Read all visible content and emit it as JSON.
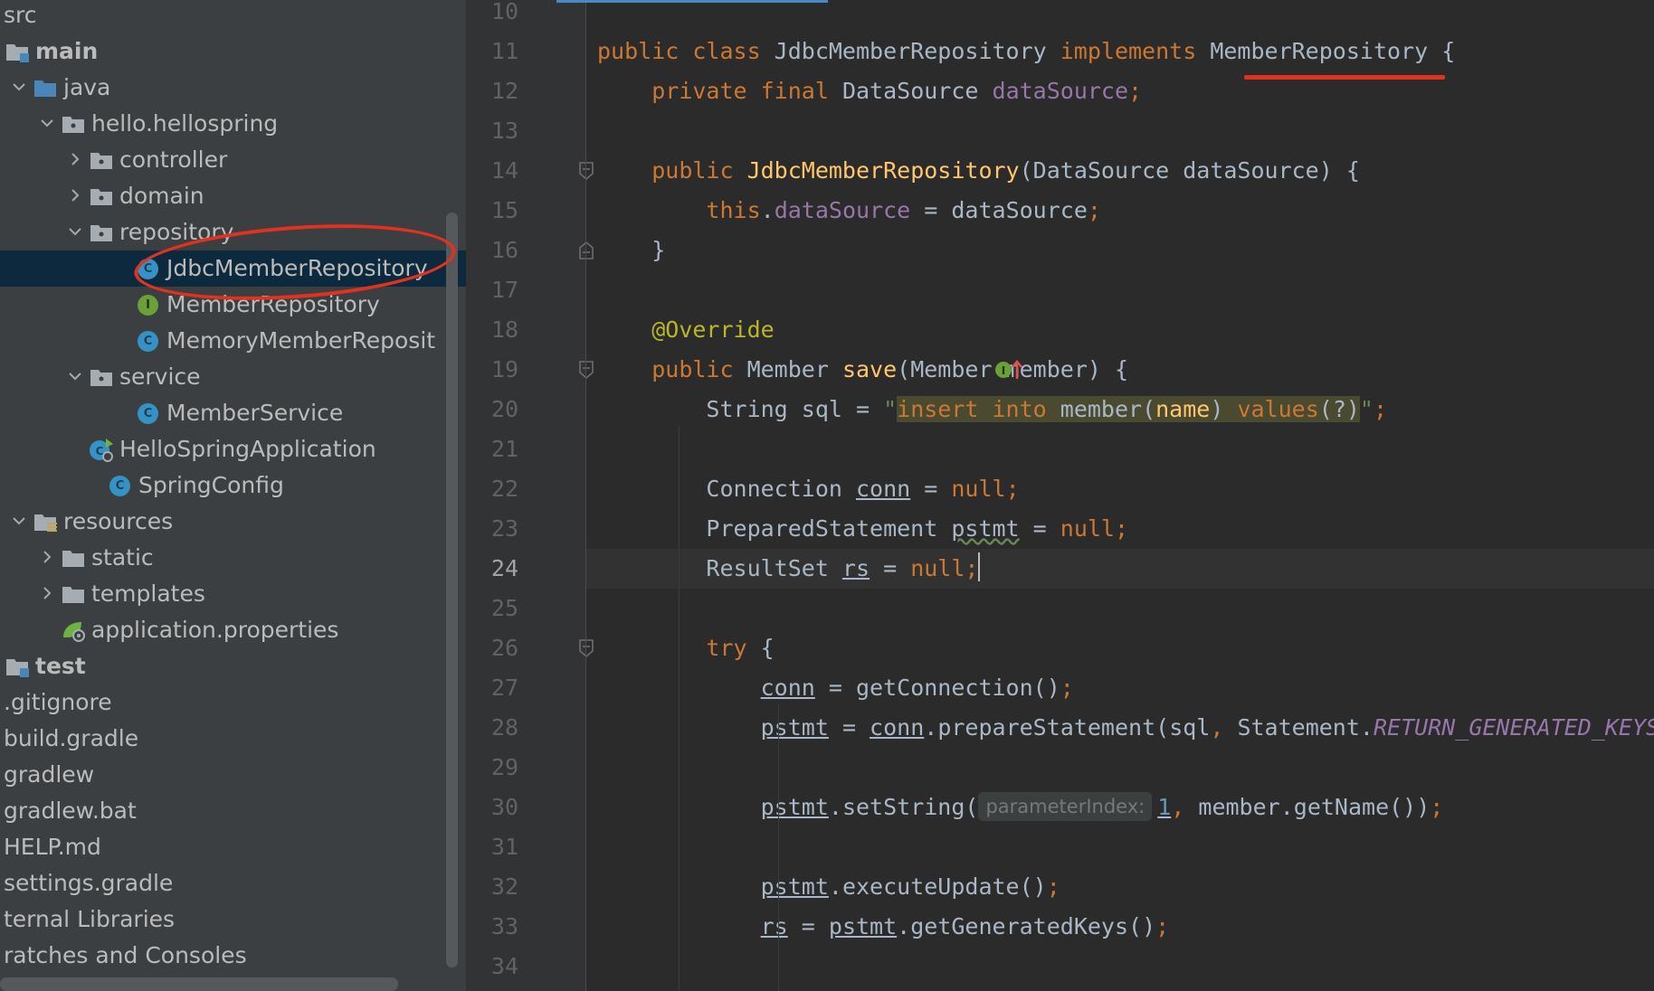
{
  "tree": {
    "items": [
      {
        "label": "src",
        "depth": 0,
        "icon": "none",
        "chevron": "none"
      },
      {
        "label": "main",
        "depth": 0,
        "icon": "module-folder-icon",
        "chevron": "none",
        "bold": true
      },
      {
        "label": "java",
        "depth": 1,
        "icon": "source-folder-icon",
        "chevron": "down"
      },
      {
        "label": "hello.hellospring",
        "depth": 2,
        "icon": "package-icon",
        "chevron": "down"
      },
      {
        "label": "controller",
        "depth": 3,
        "icon": "package-icon",
        "chevron": "right"
      },
      {
        "label": "domain",
        "depth": 3,
        "icon": "package-icon",
        "chevron": "right"
      },
      {
        "label": "repository",
        "depth": 3,
        "icon": "package-icon",
        "chevron": "down"
      },
      {
        "label": "JdbcMemberRepository",
        "depth": 4,
        "icon": "class-icon",
        "chevron": "none",
        "selected": true
      },
      {
        "label": "MemberRepository",
        "depth": 4,
        "icon": "interface-icon",
        "chevron": "none"
      },
      {
        "label": "MemoryMemberReposit",
        "depth": 4,
        "icon": "class-icon",
        "chevron": "none"
      },
      {
        "label": "service",
        "depth": 3,
        "icon": "package-icon",
        "chevron": "down"
      },
      {
        "label": "MemberService",
        "depth": 4,
        "icon": "class-icon",
        "chevron": "none"
      },
      {
        "label": "HelloSpringApplication",
        "depth": 3,
        "icon": "spring-boot-class-icon",
        "chevron": "none"
      },
      {
        "label": "SpringConfig",
        "depth": 3,
        "icon": "class-icon",
        "chevron": "none"
      },
      {
        "label": "resources",
        "depth": 1,
        "icon": "resources-folder-icon",
        "chevron": "down"
      },
      {
        "label": "static",
        "depth": 2,
        "icon": "folder-icon",
        "chevron": "right"
      },
      {
        "label": "templates",
        "depth": 2,
        "icon": "folder-icon",
        "chevron": "right"
      },
      {
        "label": "application.properties",
        "depth": 2,
        "icon": "spring-properties-icon",
        "chevron": "none"
      },
      {
        "label": "test",
        "depth": 0,
        "icon": "module-folder-icon",
        "chevron": "none",
        "bold": true
      },
      {
        "label": ".gitignore",
        "depth": 0,
        "icon": "none",
        "chevron": "none"
      },
      {
        "label": "build.gradle",
        "depth": 0,
        "icon": "none",
        "chevron": "none"
      },
      {
        "label": "gradlew",
        "depth": 0,
        "icon": "none",
        "chevron": "none"
      },
      {
        "label": "gradlew.bat",
        "depth": 0,
        "icon": "none",
        "chevron": "none"
      },
      {
        "label": "HELP.md",
        "depth": 0,
        "icon": "none",
        "chevron": "none"
      },
      {
        "label": "settings.gradle",
        "depth": 0,
        "icon": "none",
        "chevron": "none"
      },
      {
        "label": "ternal Libraries",
        "depth": 0,
        "icon": "none",
        "chevron": "none"
      },
      {
        "label": "ratches and Consoles",
        "depth": 0,
        "icon": "none",
        "chevron": "none"
      }
    ]
  },
  "editor": {
    "current_line": "24",
    "lines": [
      {
        "num": "10",
        "tokens": []
      },
      {
        "num": "11",
        "tokens": [
          [
            "k",
            "public class "
          ],
          [
            "",
            "JdbcMemberRepository "
          ],
          [
            "k",
            "implements "
          ],
          [
            "",
            "MemberRepository {"
          ]
        ]
      },
      {
        "num": "12",
        "tokens": [
          [
            "",
            "    "
          ],
          [
            "k",
            "private final "
          ],
          [
            "",
            "DataSource "
          ],
          [
            "f",
            "dataSource"
          ],
          [
            "k",
            ";"
          ]
        ]
      },
      {
        "num": "13",
        "tokens": []
      },
      {
        "num": "14",
        "tokens": [
          [
            "",
            "    "
          ],
          [
            "k",
            "public "
          ],
          [
            "m",
            "JdbcMemberRepository"
          ],
          [
            "",
            "(DataSource dataSource) {"
          ]
        ]
      },
      {
        "num": "15",
        "tokens": [
          [
            "",
            "        "
          ],
          [
            "k",
            "this"
          ],
          [
            "",
            "."
          ],
          [
            "f",
            "dataSource"
          ],
          [
            "",
            " = dataSource"
          ],
          [
            "k",
            ";"
          ]
        ]
      },
      {
        "num": "16",
        "tokens": [
          [
            "",
            "    }"
          ]
        ]
      },
      {
        "num": "17",
        "tokens": []
      },
      {
        "num": "18",
        "tokens": [
          [
            "",
            "    "
          ],
          [
            "a",
            "@Override"
          ]
        ]
      },
      {
        "num": "19",
        "tokens": [
          [
            "",
            "    "
          ],
          [
            "k",
            "public "
          ],
          [
            "",
            "Member "
          ],
          [
            "m",
            "save"
          ],
          [
            "",
            "(Member member) {"
          ]
        ]
      },
      {
        "num": "20",
        "tokens": [
          [
            "",
            "        String sql = "
          ],
          [
            "s",
            "\""
          ],
          [
            "sqlk",
            "insert into "
          ],
          [
            "sqlp",
            "member("
          ],
          [
            "sqlid",
            "name"
          ],
          [
            "sqlp",
            ") "
          ],
          [
            "sqlk",
            "values"
          ],
          [
            "sqlp",
            "(?)"
          ],
          [
            "s",
            "\""
          ],
          [
            "k",
            ";"
          ]
        ]
      },
      {
        "num": "21",
        "tokens": []
      },
      {
        "num": "22",
        "tokens": [
          [
            "",
            "        Connection "
          ],
          [
            "u",
            "conn"
          ],
          [
            "",
            " = "
          ],
          [
            "k",
            "null;"
          ]
        ]
      },
      {
        "num": "23",
        "tokens": [
          [
            "",
            "        PreparedStatement "
          ],
          [
            "uw",
            "pstmt"
          ],
          [
            "",
            " = "
          ],
          [
            "k",
            "null;"
          ]
        ]
      },
      {
        "num": "24",
        "tokens": [
          [
            "",
            "        ResultSet "
          ],
          [
            "u",
            "rs"
          ],
          [
            "",
            " = "
          ],
          [
            "k",
            "null;"
          ],
          [
            "caret",
            ""
          ]
        ]
      },
      {
        "num": "25",
        "tokens": []
      },
      {
        "num": "26",
        "tokens": [
          [
            "",
            "        "
          ],
          [
            "k",
            "try "
          ],
          [
            "",
            "{"
          ]
        ]
      },
      {
        "num": "27",
        "tokens": [
          [
            "",
            "            "
          ],
          [
            "u",
            "conn"
          ],
          [
            "",
            " = getConnection()"
          ],
          [
            "k",
            ";"
          ]
        ]
      },
      {
        "num": "28",
        "tokens": [
          [
            "",
            "            "
          ],
          [
            "u",
            "pstmt"
          ],
          [
            "",
            " = "
          ],
          [
            "u",
            "conn"
          ],
          [
            "",
            ".prepareStatement(sql"
          ],
          [
            "k",
            ", "
          ],
          [
            "",
            "Statement."
          ],
          [
            "fi",
            "RETURN_GENERATED_KEYS"
          ]
        ]
      },
      {
        "num": "29",
        "tokens": []
      },
      {
        "num": "30",
        "tokens": [
          [
            "",
            "            "
          ],
          [
            "u",
            "pstmt"
          ],
          [
            "",
            ".setString("
          ],
          [
            "hint",
            "parameterIndex:"
          ],
          [
            "nu",
            "1"
          ],
          [
            "k",
            ", "
          ],
          [
            "",
            "member.getName())"
          ],
          [
            "k",
            ";"
          ]
        ]
      },
      {
        "num": "31",
        "tokens": []
      },
      {
        "num": "32",
        "tokens": [
          [
            "",
            "            "
          ],
          [
            "u",
            "pstmt"
          ],
          [
            "",
            ".executeUpdate()"
          ],
          [
            "k",
            ";"
          ]
        ]
      },
      {
        "num": "33",
        "tokens": [
          [
            "",
            "            "
          ],
          [
            "u",
            "rs"
          ],
          [
            "",
            " = "
          ],
          [
            "u",
            "pstmt"
          ],
          [
            "",
            ".getGeneratedKeys()"
          ],
          [
            "k",
            ";"
          ]
        ]
      },
      {
        "num": "34",
        "tokens": []
      }
    ]
  },
  "colors": {
    "annotation_red": "#e0321f",
    "keyword": "#cc7832",
    "field": "#9876aa",
    "method": "#ffc66d",
    "selection": "#0d293e"
  }
}
